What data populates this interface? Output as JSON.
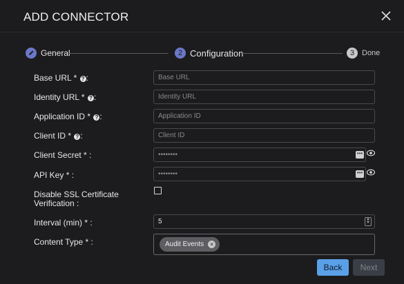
{
  "dialog": {
    "title": "ADD CONNECTOR"
  },
  "stepper": {
    "steps": [
      {
        "label": "General",
        "number": ""
      },
      {
        "label": "Configuration",
        "number": "2"
      },
      {
        "label": "Done",
        "number": "3"
      }
    ],
    "colors": {
      "completed": "#6b78c8",
      "active": "#6b78c8",
      "pending": "#c8c8c8"
    }
  },
  "form": {
    "base_url": {
      "label": "Base URL * ",
      "suffix": ":",
      "placeholder": "Base URL",
      "value": ""
    },
    "identity_url": {
      "label": "Identity URL * ",
      "suffix": ":",
      "placeholder": "Identity URL",
      "value": ""
    },
    "application_id": {
      "label": "Application ID * ",
      "suffix": ":",
      "placeholder": "Application ID",
      "value": ""
    },
    "client_id": {
      "label": "Client ID * ",
      "suffix": ":",
      "placeholder": "Client ID",
      "value": ""
    },
    "client_secret": {
      "label": "Client Secret * :",
      "placeholder": "••••••••"
    },
    "api_key": {
      "label": "API Key * :",
      "placeholder": "••••••••"
    },
    "disable_ssl": {
      "label_line1": "Disable SSL Certificate",
      "label_line2": "Verification  :",
      "checked": false
    },
    "interval": {
      "label": "Interval (min) * :",
      "value": "5"
    },
    "content_type": {
      "label": "Content Type * :",
      "chips": [
        "Audit Events"
      ]
    },
    "help_icon": "?"
  },
  "footer": {
    "back_label": "Back",
    "next_label": "Next"
  },
  "colors": {
    "accent": "#5aa0e8",
    "background": "#1c1c1e"
  }
}
